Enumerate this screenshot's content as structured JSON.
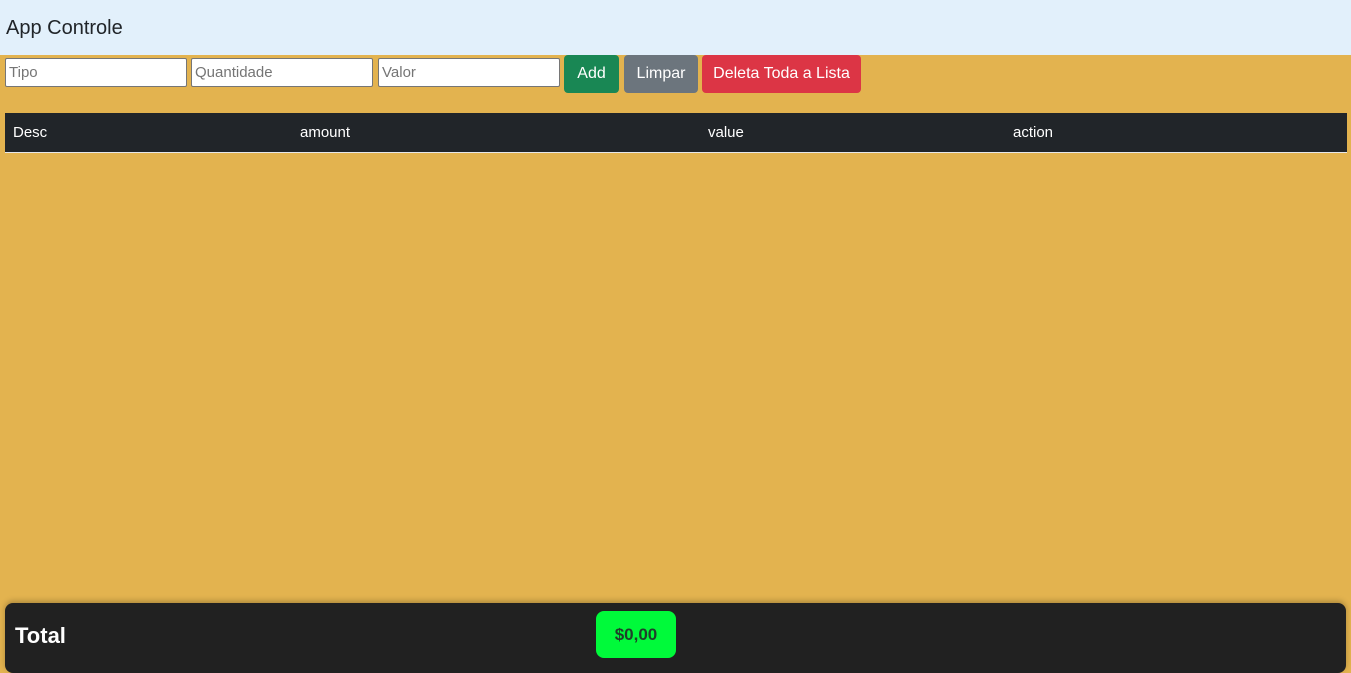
{
  "app": {
    "title": "App Controle"
  },
  "form": {
    "tipo_placeholder": "Tipo",
    "tipo_value": "",
    "quantidade_placeholder": "Quantidade",
    "quantidade_value": "",
    "valor_placeholder": "Valor",
    "valor_value": "",
    "add_label": "Add",
    "clear_label": "Limpar",
    "delete_all_label": "Deleta Toda a Lista"
  },
  "table": {
    "columns": [
      "Desc",
      "amount",
      "value",
      "action"
    ],
    "rows": []
  },
  "footer": {
    "total_label": "Total",
    "total_value": "$0,00"
  },
  "colors": {
    "page_background": "#e3b34f",
    "navbar_background": "#e2f0fb",
    "add_button": "#198754",
    "clear_button": "#6c757d",
    "delete_button": "#dc3545",
    "table_header": "#212529",
    "footer_background": "#212121",
    "total_badge": "#00fa3a"
  }
}
